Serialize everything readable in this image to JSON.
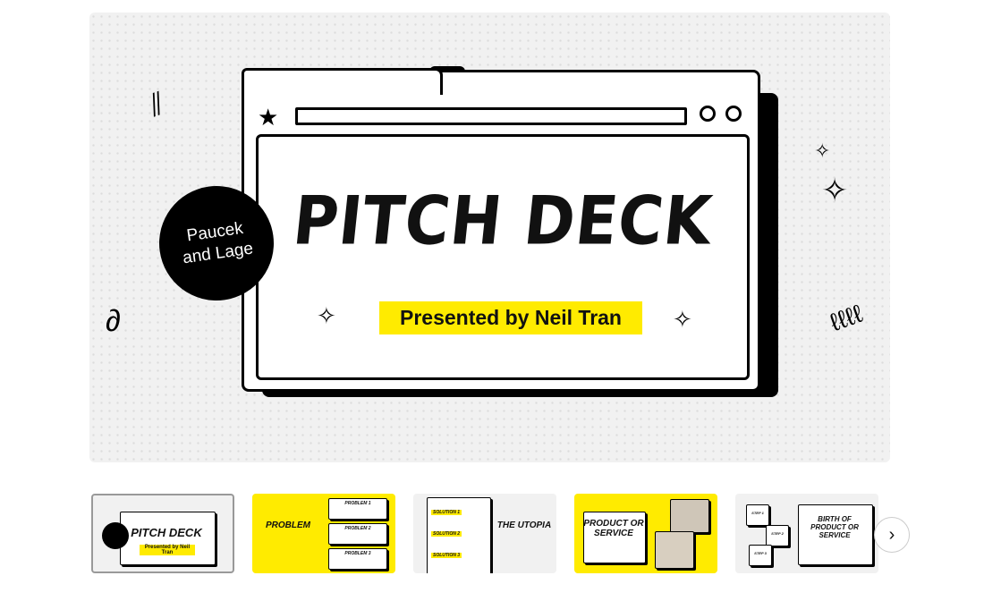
{
  "slide": {
    "title": "PITCH DECK",
    "subtitle": "Presented by Neil Tran",
    "badge": "Paucek and Lage",
    "accent_color": "#ffeb00"
  },
  "thumbnails": [
    {
      "title": "PITCH DECK",
      "subtitle": "Presented by Neil Tran",
      "selected": true
    },
    {
      "title": "PROBLEM",
      "items": [
        "PROBLEM 1",
        "PROBLEM 2",
        "PROBLEM 3"
      ]
    },
    {
      "title": "THE UTOPIA",
      "items": [
        "SOLUTION 1",
        "SOLUTION 2",
        "SOLUTION 3"
      ]
    },
    {
      "title": "PRODUCT OR SERVICE"
    },
    {
      "title": "BIRTH OF PRODUCT OR SERVICE",
      "items": [
        "STEP 1",
        "STEP 2",
        "STEP 3"
      ]
    }
  ],
  "next_button": {
    "icon": "chevron-right-icon",
    "symbol": "›"
  }
}
